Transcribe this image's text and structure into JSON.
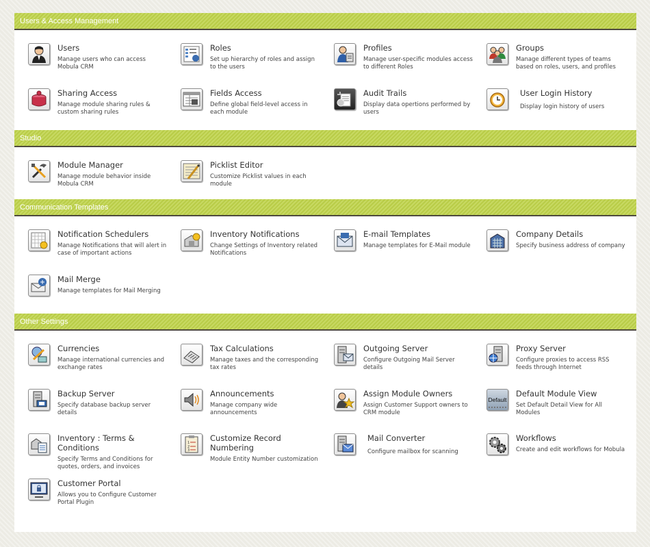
{
  "sections": [
    {
      "title": "Users & Access Management",
      "items": [
        {
          "icon": "users-icon",
          "title": "Users",
          "desc": "Manage users who can access Mobula CRM"
        },
        {
          "icon": "roles-icon",
          "title": "Roles",
          "desc": "Set up hierarchy of roles and assign to the users"
        },
        {
          "icon": "profiles-icon",
          "title": "Profiles",
          "desc": "Manage user-specific modules access to different Roles"
        },
        {
          "icon": "groups-icon",
          "title": "Groups",
          "desc": "Manage different types of teams based on roles, users, and profiles"
        },
        {
          "icon": "sharing-access-icon",
          "title": "Sharing Access",
          "desc": "Manage module sharing rules & custom sharing rules"
        },
        {
          "icon": "fields-access-icon",
          "title": "Fields Access",
          "desc": "Define global field-level access in each module"
        },
        {
          "icon": "audit-trails-icon",
          "title": "Audit Trails",
          "desc": "Display data opertions performed by users"
        },
        {
          "icon": "login-history-icon",
          "title": "User Login History",
          "desc": "Display login history of users"
        }
      ]
    },
    {
      "title": "Studio",
      "items": [
        {
          "icon": "module-manager-icon",
          "title": "Module Manager",
          "desc": "Manage module behavior inside Mobula CRM"
        },
        {
          "icon": "picklist-editor-icon",
          "title": "Picklist Editor",
          "desc": "Customize Picklist values in each module"
        }
      ]
    },
    {
      "title": "Communication Templates",
      "items": [
        {
          "icon": "notification-schedulers-icon",
          "title": "Notification Schedulers",
          "desc": "Manage Notifications that will alert in case of important actions"
        },
        {
          "icon": "inventory-notifications-icon",
          "title": "Inventory Notifications",
          "desc": "Change Settings of Inventory related Notifications"
        },
        {
          "icon": "email-templates-icon",
          "title": "E-mail Templates",
          "desc": "Manage templates for E-Mail module"
        },
        {
          "icon": "company-details-icon",
          "title": "Company Details",
          "desc": "Specify business address of company"
        },
        {
          "icon": "mail-merge-icon",
          "title": "Mail Merge",
          "desc": "Manage templates for Mail Merging"
        }
      ]
    },
    {
      "title": "Other Settings",
      "items": [
        {
          "icon": "currencies-icon",
          "title": "Currencies",
          "desc": "Manage international currencies and exchange rates"
        },
        {
          "icon": "tax-calculations-icon",
          "title": "Tax Calculations",
          "desc": "Manage taxes and the corresponding tax rates"
        },
        {
          "icon": "outgoing-server-icon",
          "title": "Outgoing Server",
          "desc": "Configure Outgoing Mail Server details"
        },
        {
          "icon": "proxy-server-icon",
          "title": "Proxy Server",
          "desc": "Configure proxies to access RSS feeds through Internet"
        },
        {
          "icon": "backup-server-icon",
          "title": "Backup Server",
          "desc": "Specify database backup server details"
        },
        {
          "icon": "announcements-icon",
          "title": "Announcements",
          "desc": "Manage company wide announcements"
        },
        {
          "icon": "assign-module-owners-icon",
          "title": "Assign Module Owners",
          "desc": "Assign Customer Support owners to CRM module"
        },
        {
          "icon": "default-module-view-icon",
          "icon_text": "Default",
          "title": "Default Module View",
          "desc": "Set Default Detail View for All Modules"
        },
        {
          "icon": "inventory-terms-icon",
          "title": "Inventory : Terms & Conditions",
          "desc": "Specify Terms and Conditions for quotes, orders, and invoices"
        },
        {
          "icon": "customize-record-numbering-icon",
          "title": "Customize Record Numbering",
          "desc": "Module Entity Number customization"
        },
        {
          "icon": "mail-converter-icon",
          "title": "Mail Converter",
          "desc": "Configure mailbox for scanning"
        },
        {
          "icon": "workflows-icon",
          "title": "Workflows",
          "desc": "Create and edit workflows for Mobula"
        },
        {
          "icon": "customer-portal-icon",
          "title": "Customer Portal",
          "desc": "Allows you to Configure Customer Portal Plugin"
        }
      ]
    }
  ]
}
